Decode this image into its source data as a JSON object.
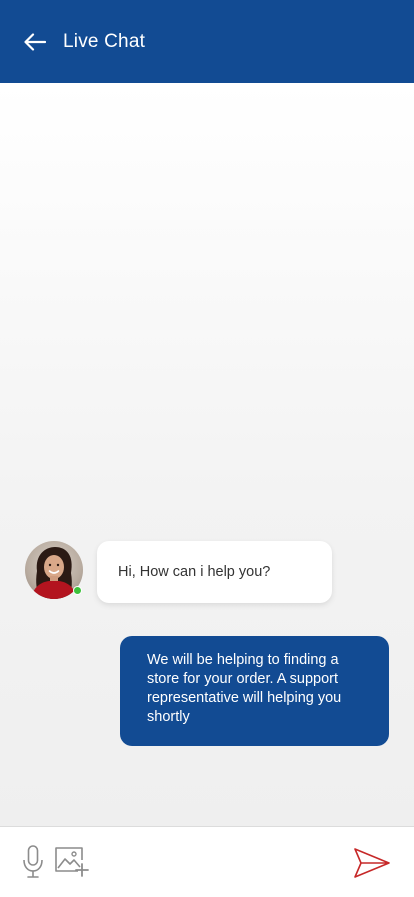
{
  "header": {
    "back_icon": "arrow-left-icon",
    "title": "Live Chat",
    "background_color": "#124b93"
  },
  "messages": [
    {
      "sender": "agent",
      "avatar": "avatar-photo",
      "online": true,
      "text": "Hi, How can i help you?"
    },
    {
      "sender": "user",
      "text": "We will be helping to finding a store for your order. A support representative will helping you shortly"
    }
  ],
  "composer": {
    "mic_icon": "microphone-icon",
    "image_icon": "add-image-icon",
    "send_icon": "send-icon",
    "send_color": "#c62828"
  },
  "colors": {
    "brand": "#124b93",
    "online": "#3cc13b"
  }
}
